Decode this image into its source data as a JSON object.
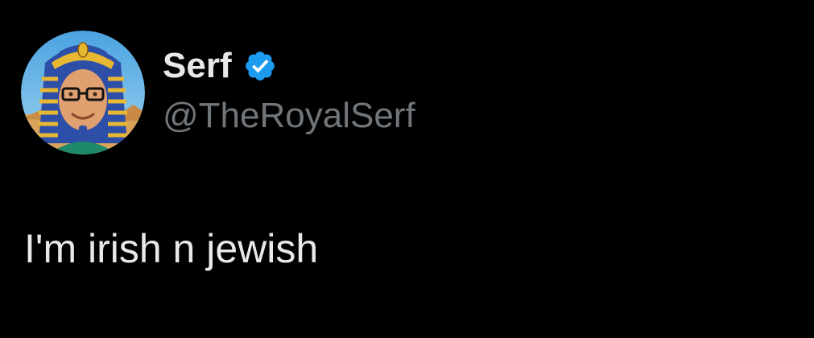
{
  "tweet": {
    "author": {
      "display_name": "Serf",
      "handle": "@TheRoyalSerf",
      "verified": true,
      "verified_icon": "verified-badge-icon",
      "verified_color": "#1d9bf0",
      "avatar": "pharaoh-with-glasses-avatar"
    },
    "text": "I'm irish n jewish"
  },
  "colors": {
    "background": "#000000",
    "primary_text": "#e7e9ea",
    "secondary_text": "#71767b",
    "accent": "#1d9bf0"
  }
}
